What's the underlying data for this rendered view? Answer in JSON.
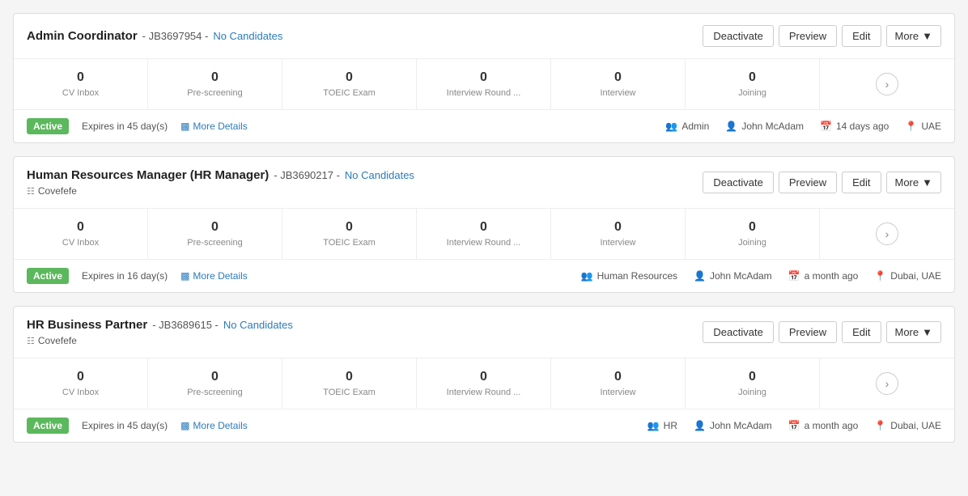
{
  "jobs": [
    {
      "id": "job-1",
      "title": "Admin Coordinator",
      "job_id": "JB3697954",
      "no_candidates_label": "No Candidates",
      "has_company": false,
      "company": "",
      "buttons": {
        "deactivate": "Deactivate",
        "preview": "Preview",
        "edit": "Edit",
        "more": "More"
      },
      "stats": [
        {
          "value": "0",
          "label": "CV Inbox"
        },
        {
          "value": "0",
          "label": "Pre-screening"
        },
        {
          "value": "0",
          "label": "TOEIC Exam"
        },
        {
          "value": "0",
          "label": "Interview Round ..."
        },
        {
          "value": "0",
          "label": "Interview"
        },
        {
          "value": "0",
          "label": "Joining"
        }
      ],
      "status": "Active",
      "expires": "Expires in 45 day(s)",
      "more_details": "More Details",
      "department": "Admin",
      "owner": "John McAdam",
      "time_ago": "14 days ago",
      "location": "UAE"
    },
    {
      "id": "job-2",
      "title": "Human Resources Manager (HR Manager)",
      "job_id": "JB3690217",
      "no_candidates_label": "No Candidates",
      "has_company": true,
      "company": "Covefefe",
      "buttons": {
        "deactivate": "Deactivate",
        "preview": "Preview",
        "edit": "Edit",
        "more": "More"
      },
      "stats": [
        {
          "value": "0",
          "label": "CV Inbox"
        },
        {
          "value": "0",
          "label": "Pre-screening"
        },
        {
          "value": "0",
          "label": "TOEIC Exam"
        },
        {
          "value": "0",
          "label": "Interview Round ..."
        },
        {
          "value": "0",
          "label": "Interview"
        },
        {
          "value": "0",
          "label": "Joining"
        }
      ],
      "status": "Active",
      "expires": "Expires in 16 day(s)",
      "more_details": "More Details",
      "department": "Human Resources",
      "owner": "John McAdam",
      "time_ago": "a month ago",
      "location": "Dubai, UAE"
    },
    {
      "id": "job-3",
      "title": "HR Business Partner",
      "job_id": "JB3689615",
      "no_candidates_label": "No Candidates",
      "has_company": true,
      "company": "Covefefe",
      "buttons": {
        "deactivate": "Deactivate",
        "preview": "Preview",
        "edit": "Edit",
        "more": "More"
      },
      "stats": [
        {
          "value": "0",
          "label": "CV Inbox"
        },
        {
          "value": "0",
          "label": "Pre-screening"
        },
        {
          "value": "0",
          "label": "TOEIC Exam"
        },
        {
          "value": "0",
          "label": "Interview Round ..."
        },
        {
          "value": "0",
          "label": "Interview"
        },
        {
          "value": "0",
          "label": "Joining"
        }
      ],
      "status": "Active",
      "expires": "Expires in 45 day(s)",
      "more_details": "More Details",
      "department": "HR",
      "owner": "John McAdam",
      "time_ago": "a month ago",
      "location": "Dubai, UAE"
    }
  ]
}
